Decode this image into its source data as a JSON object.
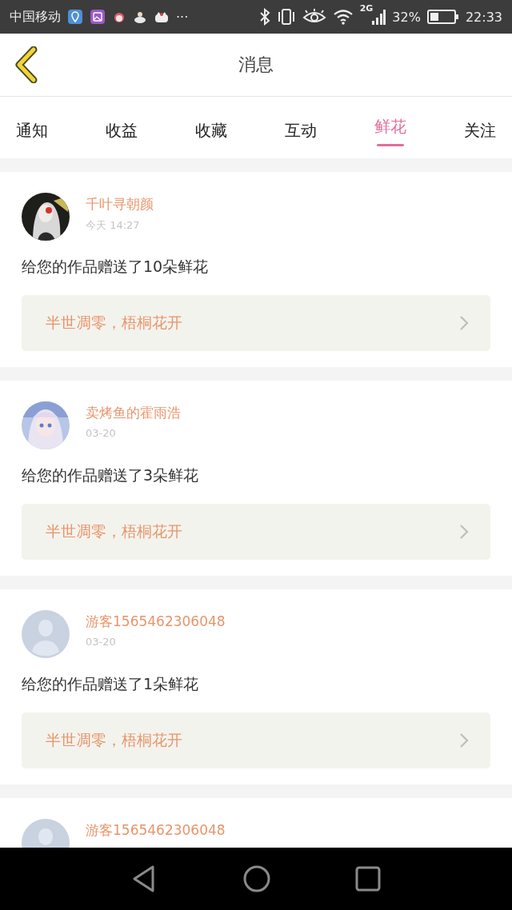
{
  "status_bar": {
    "carrier": "中国移动",
    "more": "···",
    "network": "2G",
    "battery_text": "32%",
    "time": "22:33"
  },
  "header": {
    "title": "消息"
  },
  "tabs": [
    {
      "label": "通知",
      "selected": false
    },
    {
      "label": "收益",
      "selected": false
    },
    {
      "label": "收藏",
      "selected": false
    },
    {
      "label": "互动",
      "selected": false
    },
    {
      "label": "鲜花",
      "selected": true
    },
    {
      "label": "关注",
      "selected": false
    }
  ],
  "messages": [
    {
      "name": "千叶寻朝颜",
      "time": "今天 14:27",
      "text": "给您的作品赠送了10朵鲜花",
      "work": "半世凋零，梧桐花开"
    },
    {
      "name": "卖烤鱼的霍雨浩",
      "time": "03-20",
      "text": "给您的作品赠送了3朵鲜花",
      "work": "半世凋零，梧桐花开"
    },
    {
      "avatar": {
        "kind": "default"
      },
      "name": "游客1565462306048",
      "time": "03-20",
      "text": "给您的作品赠送了1朵鲜花",
      "work": "半世凋零，梧桐花开"
    },
    {
      "avatar": {
        "kind": "default"
      },
      "name": "游客1565462306048"
    }
  ]
}
